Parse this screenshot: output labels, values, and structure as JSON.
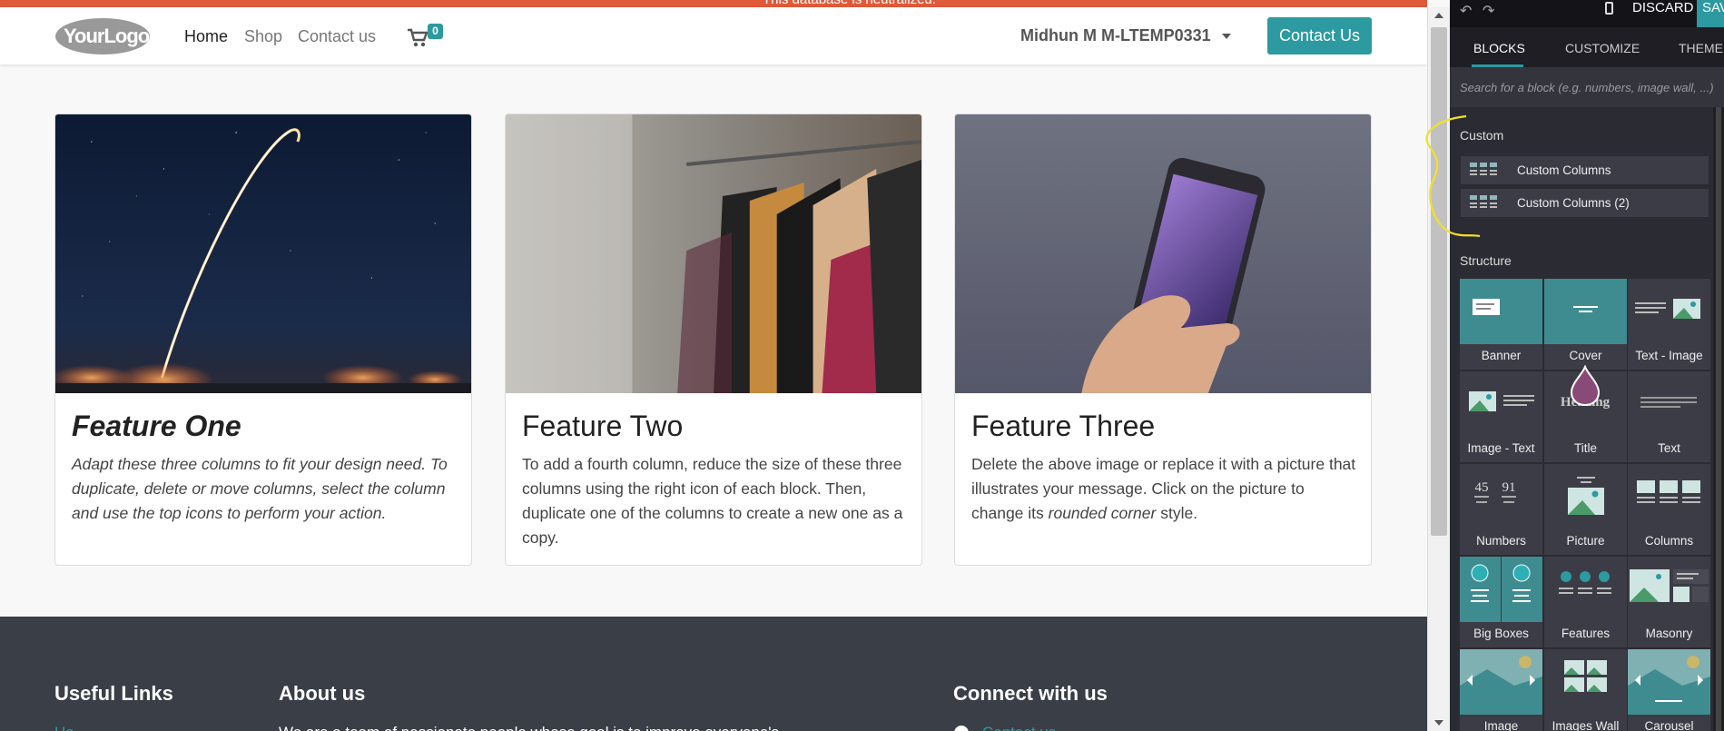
{
  "banner": {
    "text": "This database is neutralized."
  },
  "navbar": {
    "logo_text": "YourLogo",
    "links": [
      "Home",
      "Shop",
      "Contact us"
    ],
    "cart_count": "0",
    "user": "Midhun M M-LTEMP0331",
    "contact_button": "Contact Us"
  },
  "cards": [
    {
      "title": "Feature One",
      "text": "Adapt these three columns to fit your design need. To duplicate, delete or move columns, select the column and use the top icons to perform your action."
    },
    {
      "title": "Feature Two",
      "text": "To add a fourth column, reduce the size of these three columns using the right icon of each block. Then, duplicate one of the columns to create a new one as a copy."
    },
    {
      "title": "Feature Three",
      "text_before": "Delete the above image or replace it with a picture that illustrates your message. Click on the picture to change its ",
      "text_em": "rounded corner",
      "text_after": " style."
    }
  ],
  "footer": {
    "headings": [
      "Useful Links",
      "About us",
      "Connect with us"
    ],
    "fragments": [
      "Ho",
      "We are a team of passionate people whose goal is to improve everyone's",
      "Contact us"
    ]
  },
  "editor": {
    "discard_label": "DISCARD",
    "save_label": "SAVE",
    "tabs": [
      "BLOCKS",
      "CUSTOMIZE",
      "THEME"
    ],
    "search_placeholder": "Search for a block (e.g. numbers, image wall, ...)",
    "custom_section": "Custom",
    "custom_items": [
      "Custom Columns",
      "Custom Columns (2)"
    ],
    "structure_section": "Structure",
    "blocks": [
      "Banner",
      "Cover",
      "Text - Image",
      "Image - Text",
      "Title",
      "Text",
      "Numbers",
      "Picture",
      "Columns",
      "Big Boxes",
      "Features",
      "Masonry",
      "Image",
      "Images Wall",
      "Carousel"
    ],
    "numbers_thumb": [
      "45",
      "91"
    ],
    "title_thumb": "Heading"
  },
  "colors": {
    "accent": "#2c9aa0",
    "warning": "#e05a3a",
    "footer": "#3a3e46",
    "panel": "#2b2b33",
    "annotation": "#f2e027"
  }
}
